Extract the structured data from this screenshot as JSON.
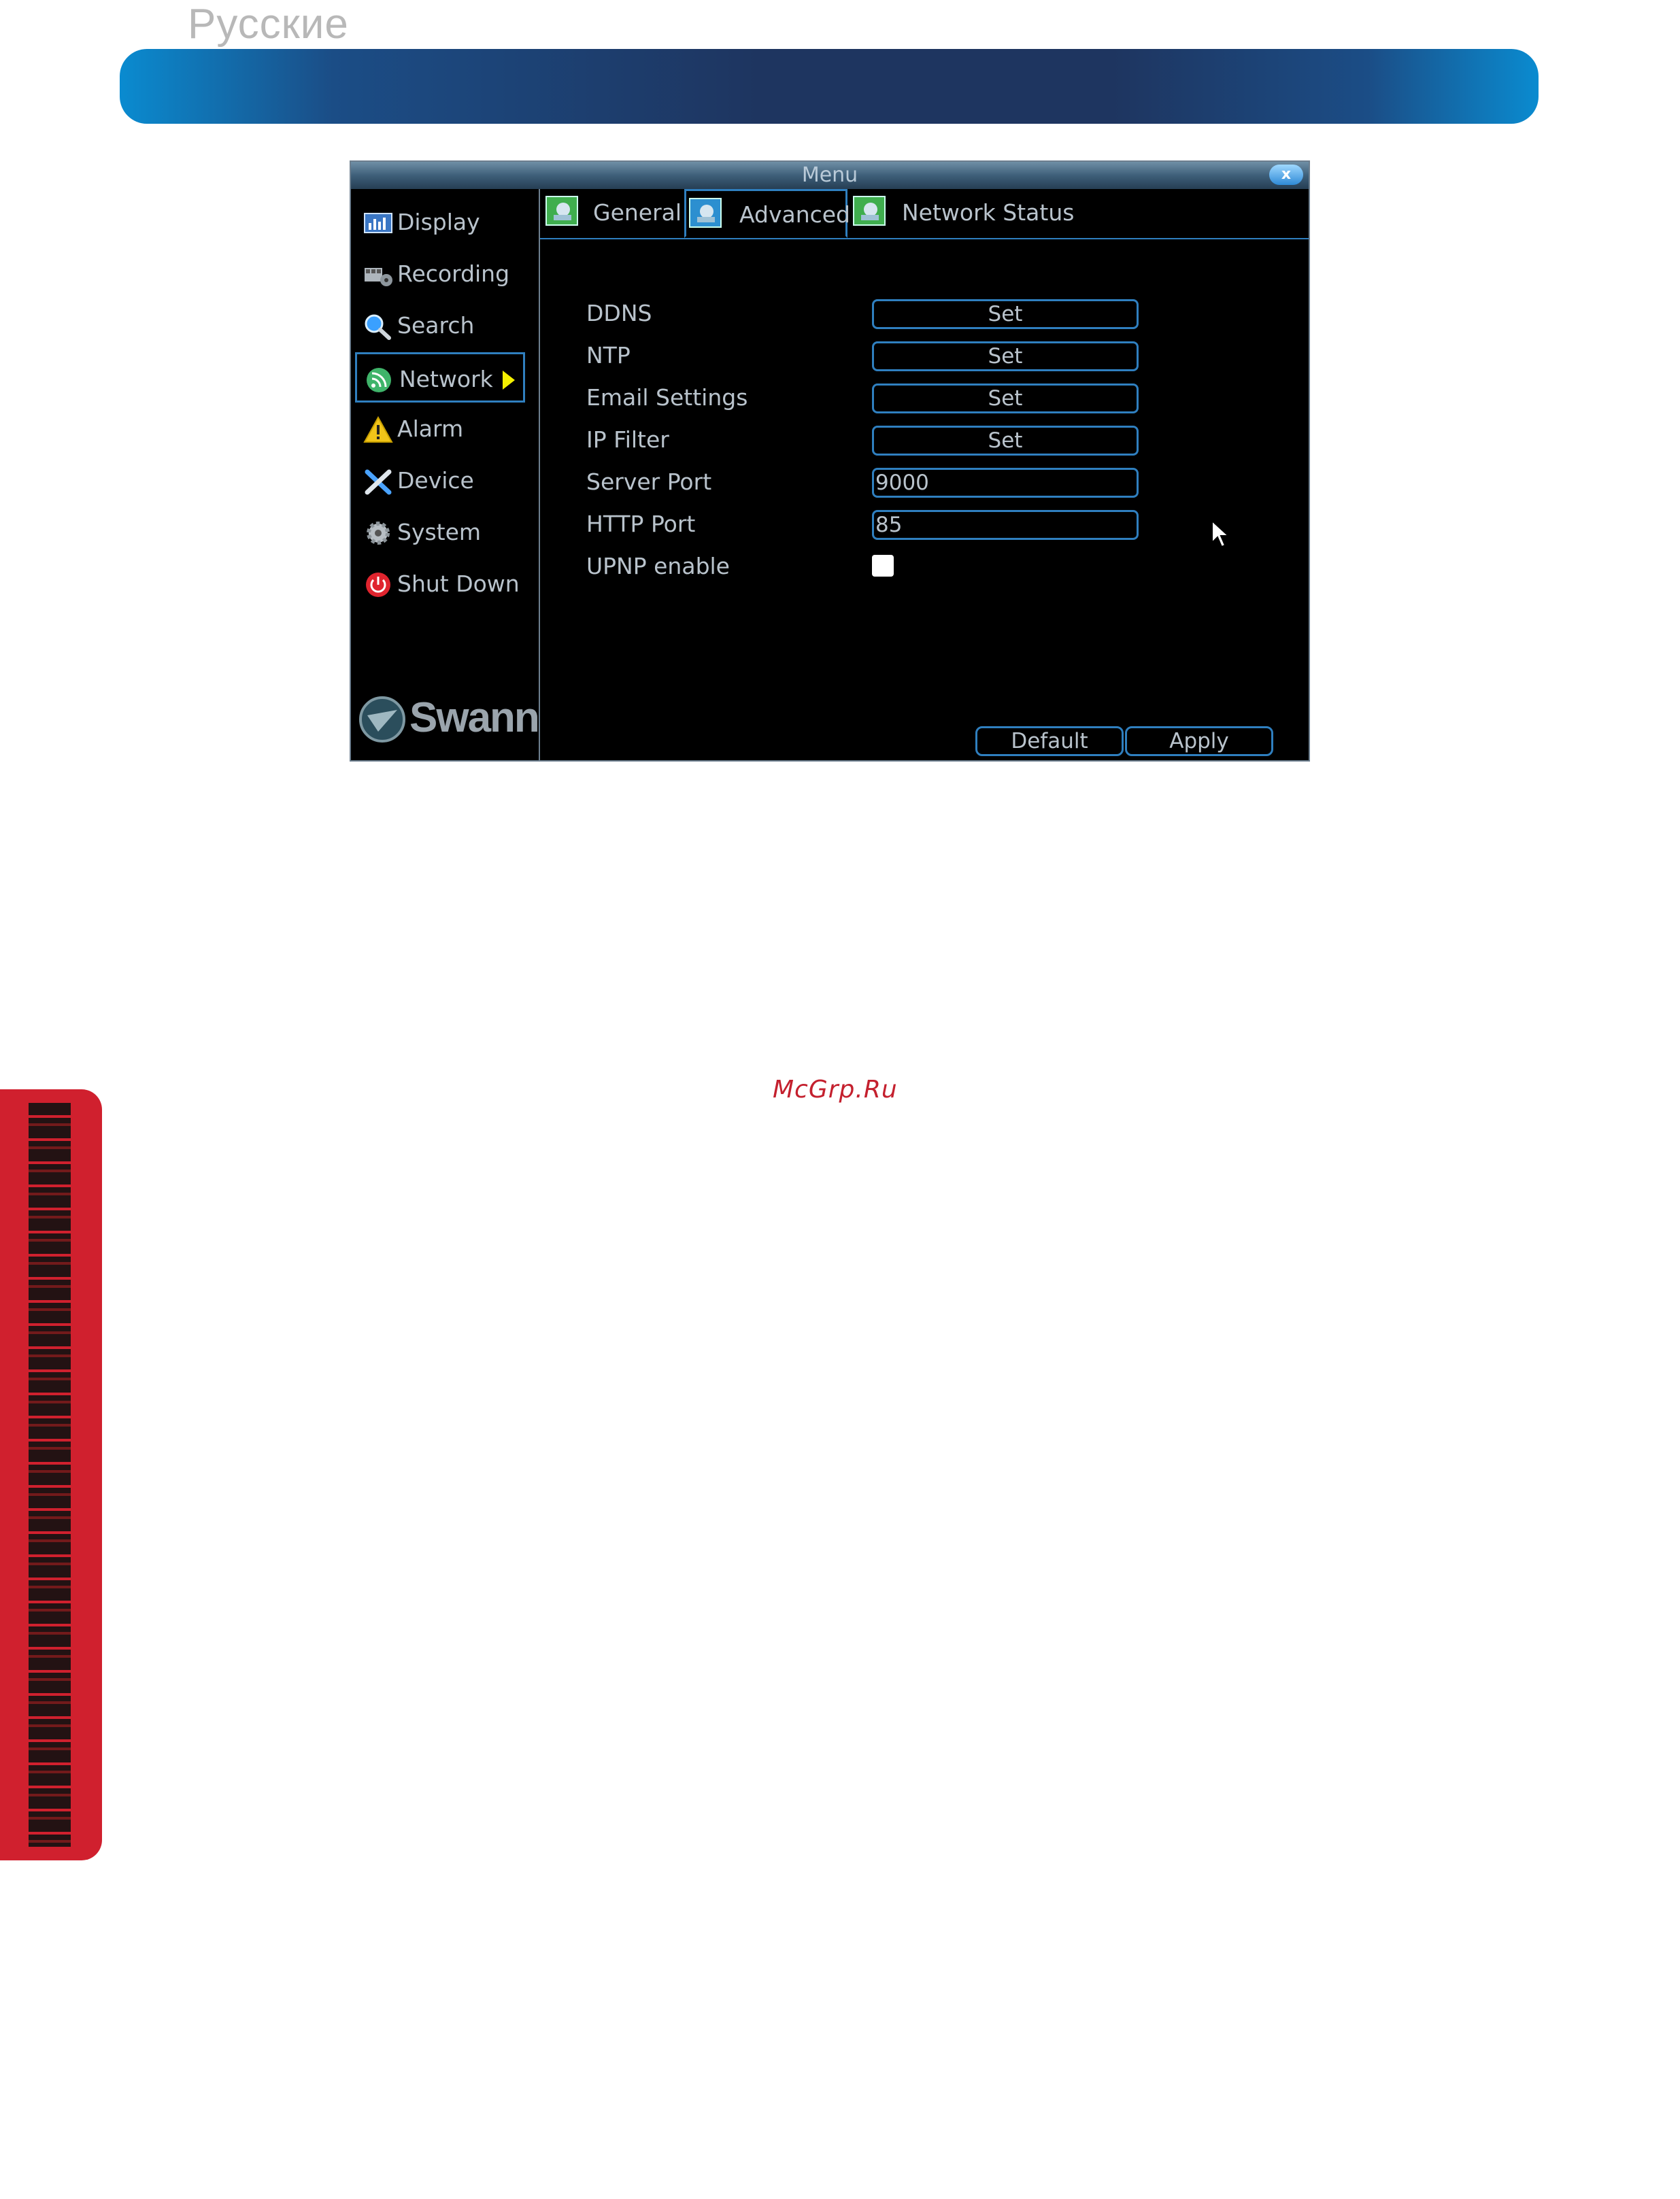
{
  "page": {
    "language_label": "Русские",
    "watermark": "McGrp.Ru"
  },
  "menu": {
    "title": "Menu",
    "close_label": "x",
    "sidebar": {
      "items": [
        {
          "label": "Display",
          "icon": "display-icon"
        },
        {
          "label": "Recording",
          "icon": "recording-icon"
        },
        {
          "label": "Search",
          "icon": "search-icon"
        },
        {
          "label": "Network",
          "icon": "network-icon",
          "active": true
        },
        {
          "label": "Alarm",
          "icon": "alarm-icon"
        },
        {
          "label": "Device",
          "icon": "device-icon"
        },
        {
          "label": "System",
          "icon": "system-icon"
        },
        {
          "label": "Shut Down",
          "icon": "power-icon"
        }
      ],
      "logo_text": "Swann"
    },
    "tabs": [
      {
        "label": "General"
      },
      {
        "label": "Advanced",
        "active": true
      },
      {
        "label": "Network Status"
      }
    ],
    "form": {
      "ddns": {
        "label": "DDNS",
        "button": "Set"
      },
      "ntp": {
        "label": "NTP",
        "button": "Set"
      },
      "email": {
        "label": "Email Settings",
        "button": "Set"
      },
      "ipfilter": {
        "label": "IP Filter",
        "button": "Set"
      },
      "server_port": {
        "label": "Server Port",
        "value": "9000"
      },
      "http_port": {
        "label": "HTTP Port",
        "value": "85"
      },
      "upnp": {
        "label": "UPNP enable",
        "checked": false
      }
    },
    "footer": {
      "default_label": "Default",
      "apply_label": "Apply"
    }
  },
  "colors": {
    "accent": "#2f7fbf",
    "banner": "#1e3560",
    "side_tab": "#d0202e",
    "watermark": "#c4202e"
  }
}
